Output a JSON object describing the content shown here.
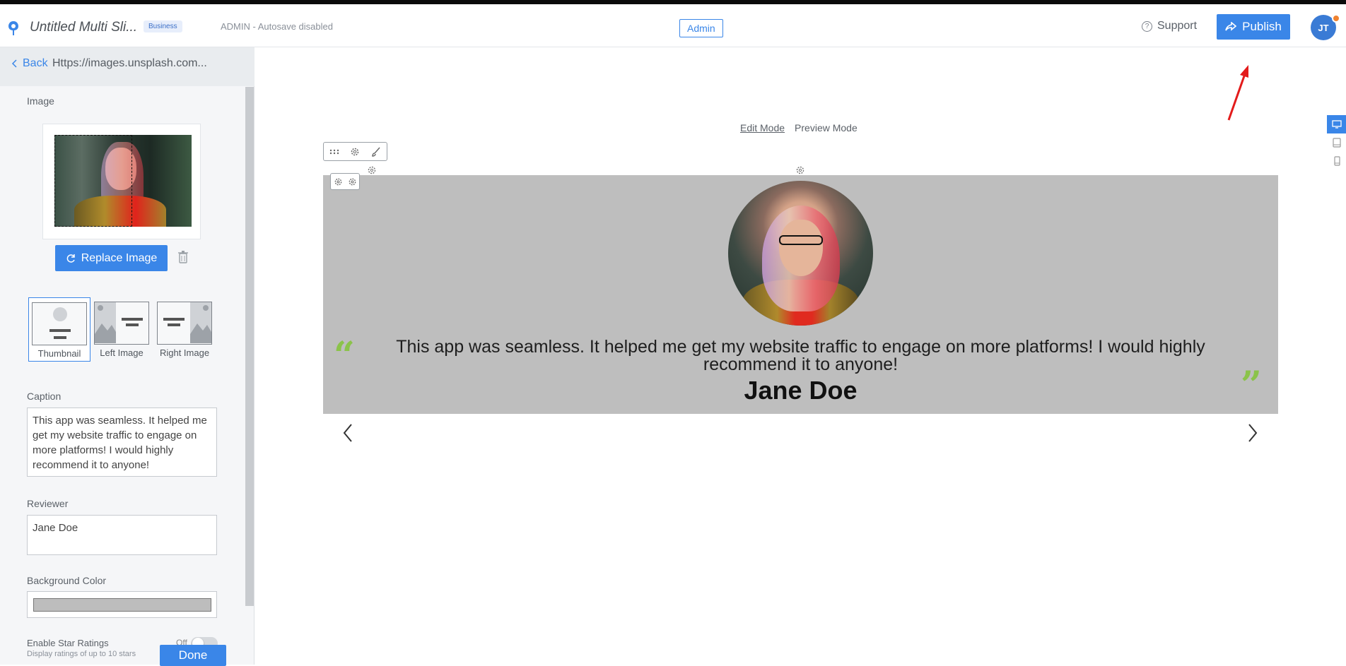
{
  "header": {
    "site_title": "Untitled Multi Sli...",
    "plan_badge": "Business",
    "autosave": "ADMIN - Autosave disabled",
    "admin_label": "Admin",
    "support_label": "Support",
    "publish_label": "Publish",
    "avatar_initials": "JT"
  },
  "sidebar": {
    "back_label": "Back",
    "back_url": "Https://images.unsplash.com...",
    "image_label": "Image",
    "replace_label": "Replace Image",
    "layouts": [
      {
        "label": "Thumbnail",
        "selected": true
      },
      {
        "label": "Left Image",
        "selected": false
      },
      {
        "label": "Right Image",
        "selected": false
      }
    ],
    "caption_label": "Caption",
    "caption_value": "This app was seamless. It helped me get my website traffic to engage on more platforms! I would highly recommend it to anyone!",
    "reviewer_label": "Reviewer",
    "reviewer_value": "Jane Doe",
    "bg_color_label": "Background Color",
    "bg_color_value": "#bdbdbd",
    "star_label": "Enable Star Ratings",
    "star_sub": "Display ratings of up to 10 stars",
    "toggle_state": "Off",
    "done_label": "Done"
  },
  "canvas": {
    "edit_mode": "Edit Mode",
    "preview_mode": "Preview Mode",
    "caption": "This app was seamless. It helped me get my website traffic to engage on more platforms! I would highly recommend it to anyone!",
    "reviewer": "Jane Doe",
    "quote_open": "“",
    "quote_close": "”",
    "slide_bg": "#bebebe",
    "accent_quote_color": "#8bc34a"
  },
  "colors": {
    "primary": "#3a86e8",
    "annotation_arrow": "#e31b1b"
  }
}
